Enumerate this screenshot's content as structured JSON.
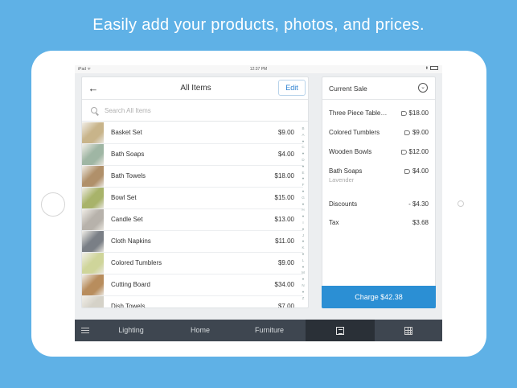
{
  "headline": "Easily add your products, photos, and prices.",
  "statusbar": {
    "device": "iPad ᯤ",
    "time": "12:37 PM",
    "right": "⬆"
  },
  "items_panel": {
    "title": "All Items",
    "edit_label": "Edit",
    "back_icon": "←",
    "search_placeholder": "Search All Items",
    "items": [
      {
        "name": "Basket Set",
        "price": "$9.00",
        "color": "#c8b48a"
      },
      {
        "name": "Bath Soaps",
        "price": "$4.00",
        "color": "#9fb6a4"
      },
      {
        "name": "Bath Towels",
        "price": "$18.00",
        "color": "#b0906a"
      },
      {
        "name": "Bowl Set",
        "price": "$15.00",
        "color": "#a8b36a"
      },
      {
        "name": "Candle Set",
        "price": "$13.00",
        "color": "#b7b2ab"
      },
      {
        "name": "Cloth Napkins",
        "price": "$11.00",
        "color": "#7a7f86"
      },
      {
        "name": "Colored Tumblers",
        "price": "$9.00",
        "color": "#cfd59a"
      },
      {
        "name": "Cutting Board",
        "price": "$34.00",
        "color": "#b88d5d"
      },
      {
        "name": "Dish Towels",
        "price": "$7.00",
        "color": "#d5d2c8"
      }
    ],
    "alpha_index": [
      "B",
      "A",
      "●",
      "C",
      "●",
      "D",
      "●",
      "E",
      "●",
      "F",
      "●",
      "G",
      "●",
      "H",
      "●",
      "I",
      "●",
      "J",
      "●",
      "K",
      "●",
      "L",
      "●",
      "M",
      "●",
      "N",
      "●",
      "Z"
    ]
  },
  "sale_panel": {
    "title": "Current Sale",
    "lines": [
      {
        "label": "Three Piece Table…",
        "amount": "$18.00",
        "sub": ""
      },
      {
        "label": "Colored Tumblers",
        "amount": "$9.00",
        "sub": ""
      },
      {
        "label": "Wooden Bowls",
        "amount": "$12.00",
        "sub": ""
      },
      {
        "label": "Bath Soaps",
        "amount": "$4.00",
        "sub": "Lavender"
      }
    ],
    "discounts_label": "Discounts",
    "discounts_amount": "- $4.30",
    "tax_label": "Tax",
    "tax_amount": "$3.68",
    "charge_label": "Charge $42.38"
  },
  "bottombar": {
    "tabs": [
      "Lighting",
      "Home",
      "Furniture"
    ]
  },
  "colors": {
    "background": "#5fb1e6",
    "accent": "#2b8fd4",
    "bottombar": "#3e4650"
  }
}
